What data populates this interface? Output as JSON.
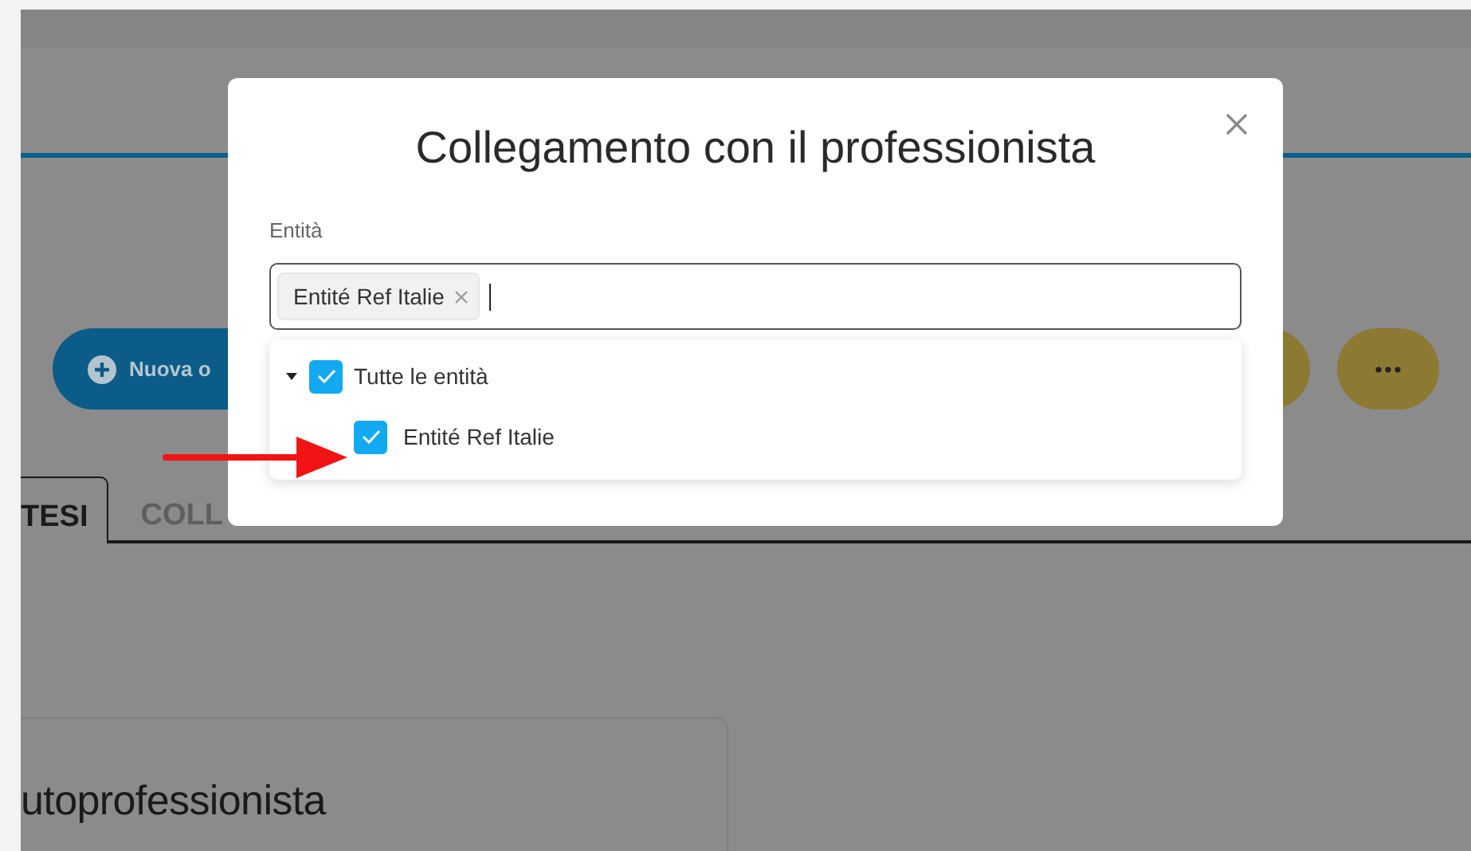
{
  "background": {
    "new_button": "Nuova o",
    "tabs": [
      {
        "label": "TESI",
        "selected": true
      },
      {
        "label": "COLL",
        "selected": false
      }
    ],
    "card_title": "utoprofessionista"
  },
  "dialog": {
    "title": "Collegamento con il professionista",
    "field_label": "Entità",
    "tags": [
      {
        "label": "Entité Ref Italie"
      }
    ],
    "tree": [
      {
        "label": "Tutte le entità",
        "checked": true,
        "expanded": true,
        "children": [
          {
            "label": "Entité Ref Italie",
            "checked": true
          }
        ]
      }
    ]
  }
}
